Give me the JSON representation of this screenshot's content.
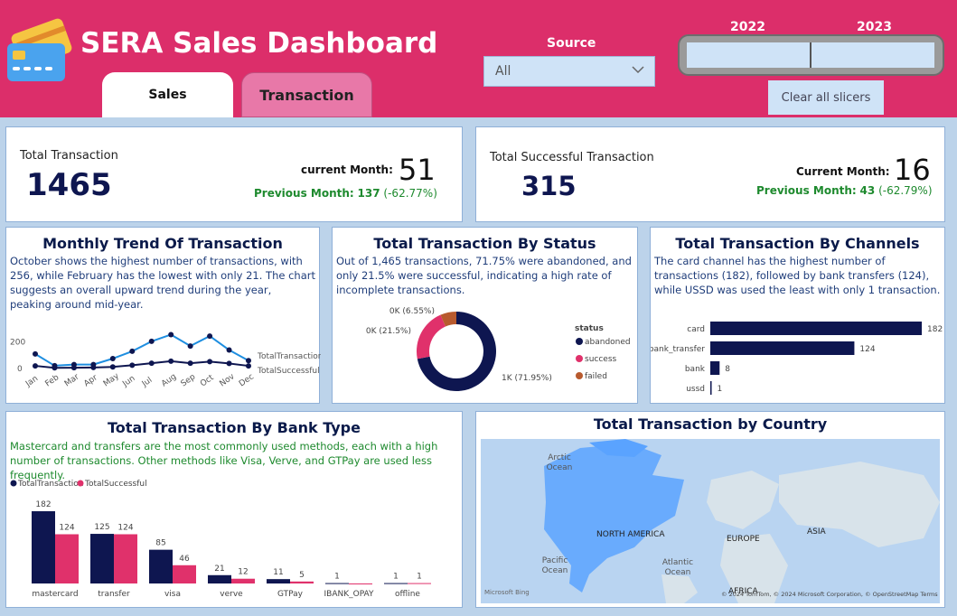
{
  "header": {
    "title": "SERA Sales Dashboard",
    "tabs": [
      {
        "label": "Sales"
      },
      {
        "label": "Transaction"
      }
    ],
    "source": {
      "label": "Source",
      "value": "All"
    },
    "years": [
      "2022",
      "2023"
    ],
    "clear_label": "Clear all slicers",
    "colors": {
      "header_bg": "#dc2e6a",
      "tab_active": "#ffffff",
      "tab_inactive": "#e878a8"
    }
  },
  "kpi_total": {
    "label": "Total Transaction",
    "value": "1465",
    "current_label": "current Month:",
    "current_value": "51",
    "prev_label": "Previous Month:",
    "prev_value": "137",
    "prev_change": "(-62.77%)"
  },
  "kpi_success": {
    "label": "Total Successful Transaction",
    "value": "315",
    "current_label": "Current Month:",
    "current_value": "16",
    "prev_label": "Previous Month:",
    "prev_value": "43",
    "prev_change": "(-62.79%)"
  },
  "monthly": {
    "title": "Monthly Trend Of Transaction",
    "desc": "October shows the highest number of transactions, with 256, while February has the lowest with only 21. The chart suggests an overall upward trend during the year, peaking around mid-year."
  },
  "status": {
    "title": "Total Transaction By Status",
    "desc": "Out of 1,465 transactions, 71.75% were abandoned, and only 21.5% were successful, indicating a high rate of incomplete transactions.",
    "legend_title": "status"
  },
  "channels": {
    "title": "Total Transaction By Channels",
    "desc": "The card channel has the highest number of transactions (182), followed by bank transfers (124), while USSD was used the least with only 1 transaction."
  },
  "bank": {
    "title": "Total Transaction By Bank Type",
    "desc": "Mastercard and transfers are the most commonly used methods, each with a high number of transactions. Other methods like Visa, Verve, and GTPay are used less frequently."
  },
  "country": {
    "title": "Total Transaction by Country",
    "labels": {
      "arctic": "Arctic Ocean",
      "north_america": "NORTH AMERICA",
      "europe": "EUROPE",
      "asia": "ASIA",
      "pacific": "Pacific Ocean",
      "atlantic": "Atlantic Ocean",
      "africa": "AFRICA"
    },
    "attribution": "© 2024 TomTom, © 2024 Microsoft Corporation, © OpenStreetMap  Terms",
    "brand": "Microsoft Bing"
  },
  "chart_data": [
    {
      "type": "line",
      "categories": [
        "Jan",
        "Feb",
        "Mar",
        "Apr",
        "May",
        "Jun",
        "Jul",
        "Aug",
        "Sep",
        "Oct",
        "Nov",
        "Dec"
      ],
      "ylim": [
        0,
        300
      ],
      "yticks": [
        "0",
        "200"
      ],
      "series": [
        {
          "name": "TotalTransaction",
          "color": "#1e8ee0",
          "values": [
            110,
            21,
            30,
            30,
            75,
            130,
            205,
            256,
            170,
            245,
            140,
            60
          ]
        },
        {
          "name": "TotalSuccessful",
          "color": "#0e1650",
          "values": [
            20,
            5,
            6,
            8,
            12,
            25,
            40,
            55,
            40,
            52,
            38,
            20
          ]
        }
      ]
    },
    {
      "type": "pie",
      "labels": [
        "abandoned",
        "success",
        "failed"
      ],
      "values": [
        71.95,
        21.5,
        6.55
      ],
      "data_labels": [
        "1K (71.95%)",
        "0K (21.5%)",
        "0K (6.55%)"
      ],
      "colors": [
        "#0e1650",
        "#e0316b",
        "#b85a2e"
      ]
    },
    {
      "type": "bar",
      "orientation": "horizontal",
      "categories": [
        "card",
        "bank_transfer",
        "bank",
        "ussd"
      ],
      "values": [
        182,
        124,
        8,
        1
      ],
      "color": "#0e1650"
    },
    {
      "type": "bar",
      "categories": [
        "mastercard",
        "transfer",
        "visa",
        "verve",
        "GTPay",
        "IBANK_OPAY",
        "offline"
      ],
      "series": [
        {
          "name": "TotalTransaction",
          "color": "#0e1650",
          "values": [
            182,
            125,
            85,
            21,
            11,
            1,
            1
          ]
        },
        {
          "name": "TotalSuccessful",
          "color": "#e0316b",
          "values": [
            124,
            124,
            46,
            12,
            5,
            0,
            1
          ]
        }
      ]
    }
  ]
}
